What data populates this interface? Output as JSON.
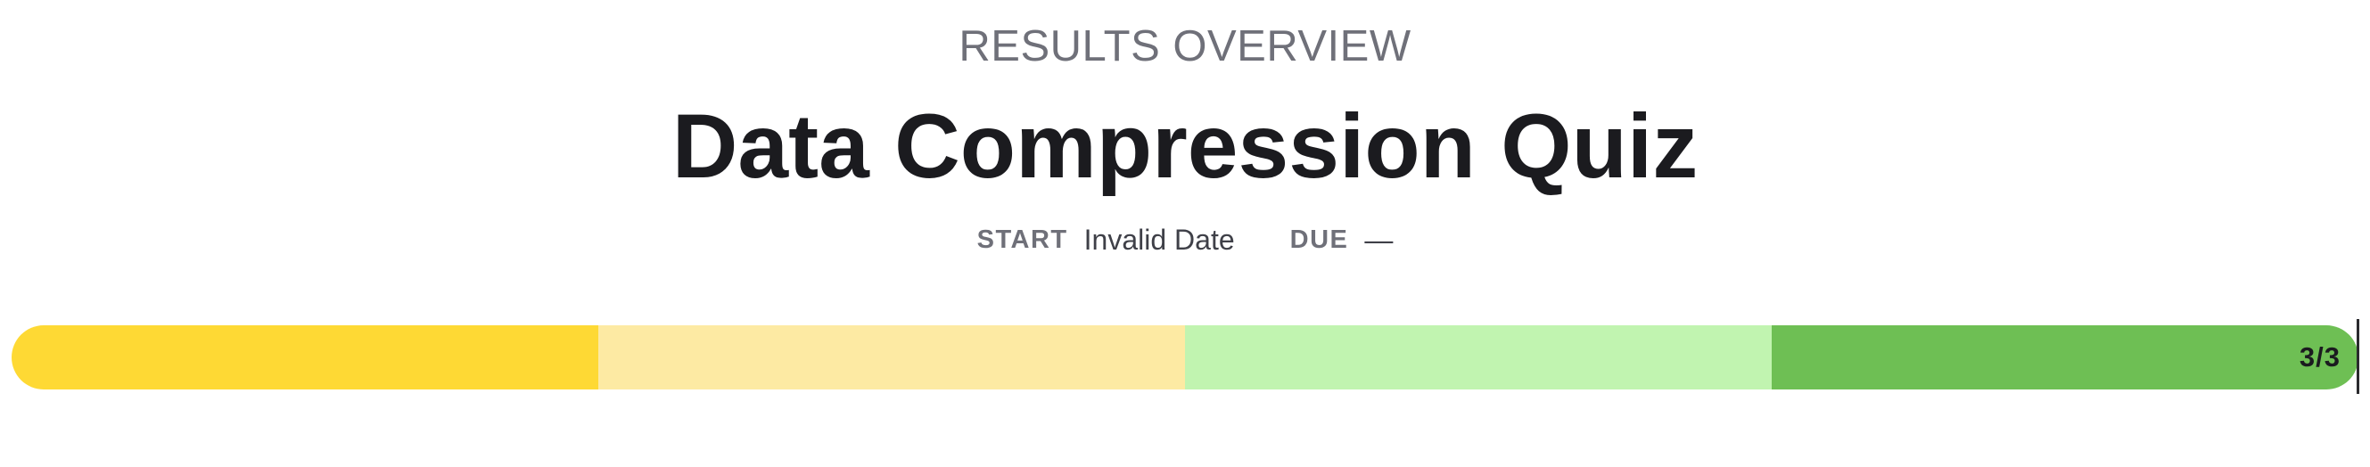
{
  "header": {
    "overline": "RESULTS OVERVIEW",
    "title": "Data Compression Quiz"
  },
  "dates": {
    "start_label": "START",
    "start_value": "Invalid Date",
    "due_label": "DUE",
    "due_value": "—"
  },
  "progress": {
    "label": "3/3",
    "completed": 3,
    "total": 3,
    "segments": [
      {
        "color": "#fed934"
      },
      {
        "color": "#fdeaa3"
      },
      {
        "color": "#c1f4b0"
      },
      {
        "color": "#6ebf54"
      }
    ]
  }
}
